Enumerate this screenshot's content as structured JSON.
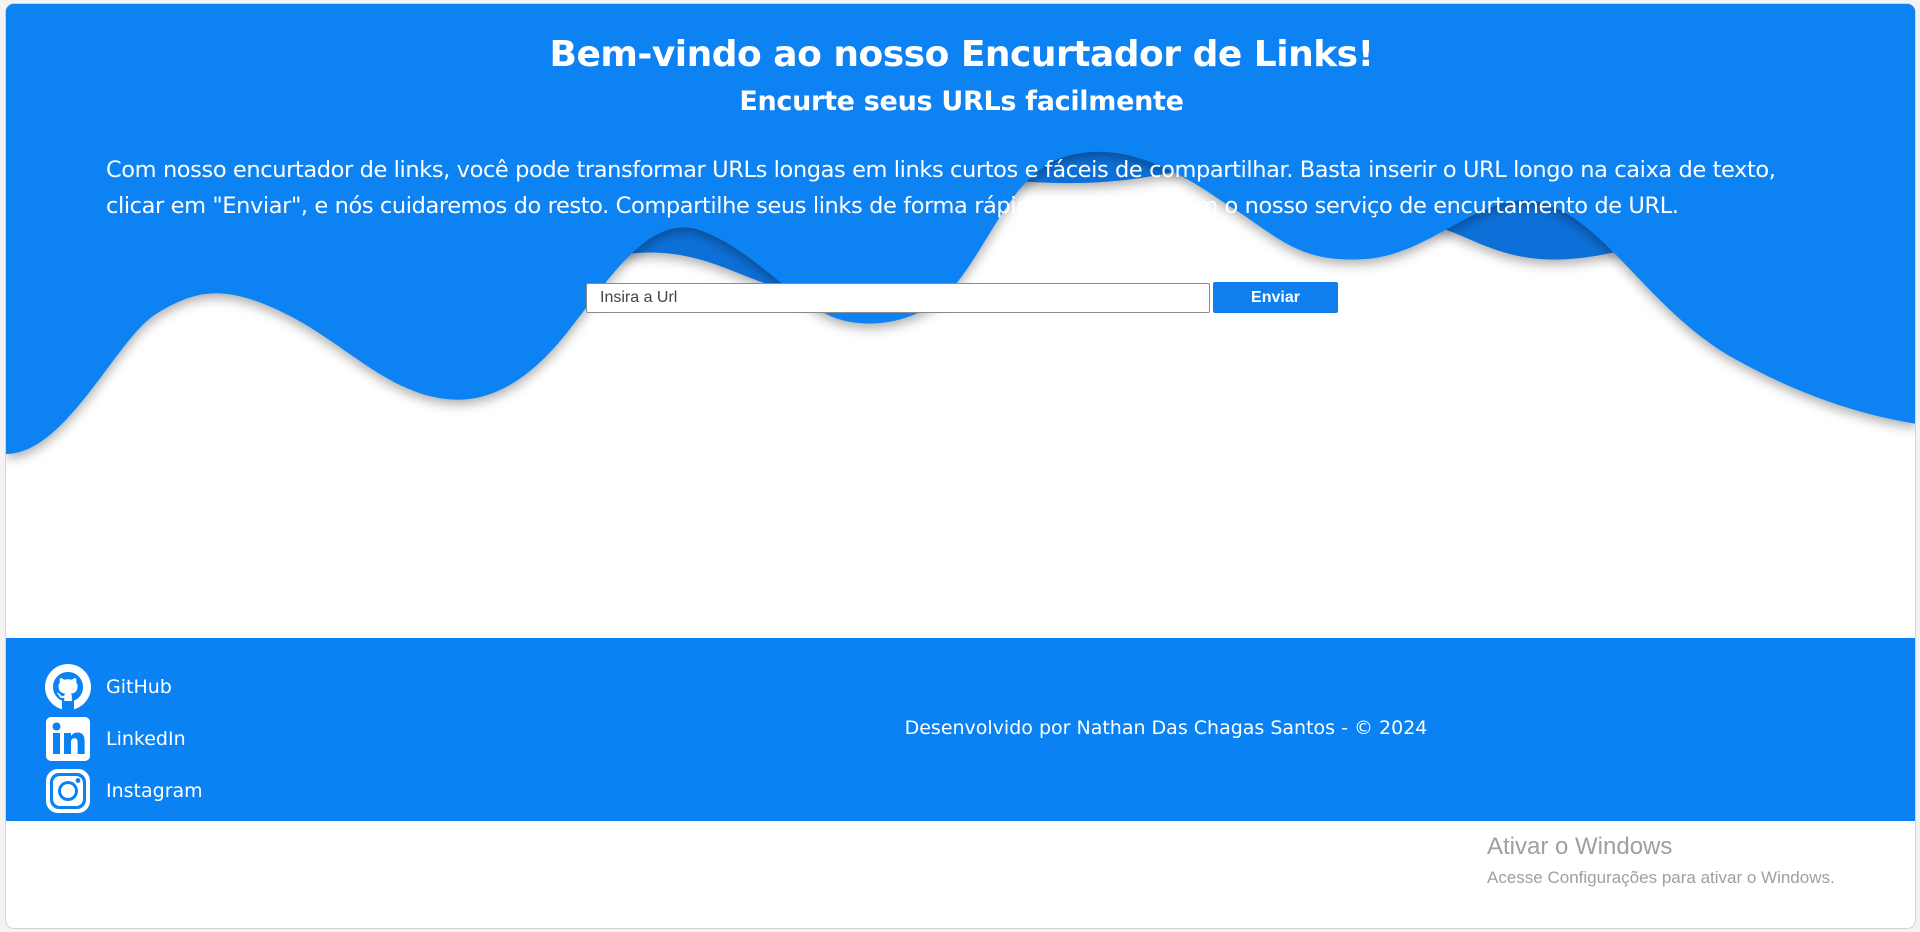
{
  "hero": {
    "title": "Bem-vindo ao nosso Encurtador de Links!",
    "subtitle": "Encurte seus URLs facilmente",
    "description": "Com nosso encurtador de links, você pode transformar URLs longas em links curtos e fáceis de compartilhar. Basta inserir o URL longo na caixa de texto, clicar em \"Enviar\", e nós cuidaremos do resto. Compartilhe seus links de forma rápida e eficiente com o nosso serviço de encurtamento de URL."
  },
  "form": {
    "input_value": "",
    "input_placeholder": "Insira a Url",
    "submit_label": "Enviar"
  },
  "footer": {
    "social": [
      {
        "label": "GitHub",
        "icon": "github-icon"
      },
      {
        "label": "LinkedIn",
        "icon": "linkedin-icon"
      },
      {
        "label": "Instagram",
        "icon": "instagram-icon"
      }
    ],
    "credits": "Desenvolvido por Nathan Das Chagas Santos - © 2024"
  },
  "watermark": {
    "title": "Ativar o Windows",
    "subtitle": "Acesse Configurações para ativar o Windows."
  },
  "colors": {
    "primary_blue": "#0a82f3",
    "wave_mid": "#0a6fd8",
    "wave_dark": "#0557b0",
    "wave_darkest": "#033d85",
    "button_blue": "#0f7ff0"
  }
}
